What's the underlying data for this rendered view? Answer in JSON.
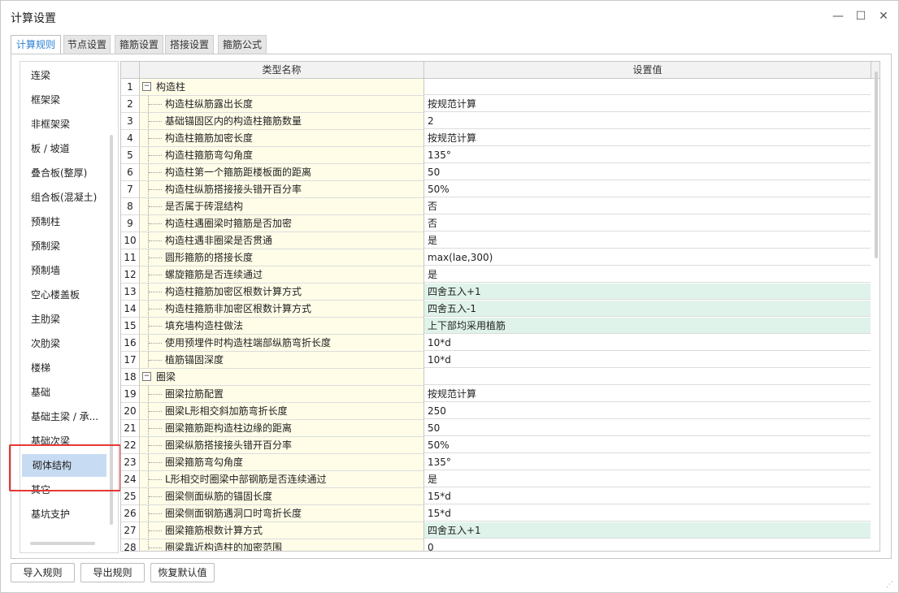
{
  "window": {
    "title": "计算设置",
    "minimize": "—",
    "maximize": "☐",
    "close": "✕"
  },
  "tabs": [
    {
      "label": "计算规则",
      "active": true
    },
    {
      "label": "节点设置"
    },
    {
      "label": "箍筋设置"
    },
    {
      "label": "搭接设置"
    },
    {
      "label": "箍筋公式"
    }
  ],
  "sidebar": {
    "items": [
      "连梁",
      "框架梁",
      "非框架梁",
      "板 / 坡道",
      "叠合板(整厚)",
      "组合板(混凝土)",
      "预制柱",
      "预制梁",
      "预制墙",
      "空心楼盖板",
      "主肋梁",
      "次肋梁",
      "楼梯",
      "基础",
      "基础主梁 / 承...",
      "基础次梁",
      "砌体结构",
      "其它",
      "基坑支护"
    ],
    "selected_index": 16
  },
  "grid": {
    "headers": {
      "name": "类型名称",
      "value": "设置值"
    },
    "rows": [
      {
        "no": "1",
        "name": "构造柱",
        "value": "",
        "group": true
      },
      {
        "no": "2",
        "name": "构造柱纵筋露出长度",
        "value": "按规范计算"
      },
      {
        "no": "3",
        "name": "基础锚固区内的构造柱箍筋数量",
        "value": "2"
      },
      {
        "no": "4",
        "name": "构造柱箍筋加密长度",
        "value": "按规范计算"
      },
      {
        "no": "5",
        "name": "构造柱箍筋弯勾角度",
        "value": "135°"
      },
      {
        "no": "6",
        "name": "构造柱第一个箍筋距楼板面的距离",
        "value": "50"
      },
      {
        "no": "7",
        "name": "构造柱纵筋搭接接头错开百分率",
        "value": "50%"
      },
      {
        "no": "8",
        "name": "是否属于砖混结构",
        "value": "否"
      },
      {
        "no": "9",
        "name": "构造柱遇圈梁时箍筋是否加密",
        "value": "否"
      },
      {
        "no": "10",
        "name": "构造柱遇非圈梁是否贯通",
        "value": "是"
      },
      {
        "no": "11",
        "name": "圆形箍筋的搭接长度",
        "value": "max(lae,300)"
      },
      {
        "no": "12",
        "name": "螺旋箍筋是否连续通过",
        "value": "是"
      },
      {
        "no": "13",
        "name": "构造柱箍筋加密区根数计算方式",
        "value": "四舍五入+1",
        "highlight": true
      },
      {
        "no": "14",
        "name": "构造柱箍筋非加密区根数计算方式",
        "value": "四舍五入-1",
        "highlight": true
      },
      {
        "no": "15",
        "name": "填充墙构造柱做法",
        "value": "上下部均采用植筋",
        "highlight": true
      },
      {
        "no": "16",
        "name": "使用预埋件时构造柱端部纵筋弯折长度",
        "value": "10*d"
      },
      {
        "no": "17",
        "name": "植筋锚固深度",
        "value": "10*d"
      },
      {
        "no": "18",
        "name": "圈梁",
        "value": "",
        "group": true
      },
      {
        "no": "19",
        "name": "圈梁拉筋配置",
        "value": "按规范计算"
      },
      {
        "no": "20",
        "name": "圈梁L形相交斜加筋弯折长度",
        "value": "250"
      },
      {
        "no": "21",
        "name": "圈梁箍筋距构造柱边缘的距离",
        "value": "50"
      },
      {
        "no": "22",
        "name": "圈梁纵筋搭接接头错开百分率",
        "value": "50%"
      },
      {
        "no": "23",
        "name": "圈梁箍筋弯勾角度",
        "value": "135°"
      },
      {
        "no": "24",
        "name": "L形相交时圈梁中部钢筋是否连续通过",
        "value": "是"
      },
      {
        "no": "25",
        "name": "圈梁侧面纵筋的锚固长度",
        "value": "15*d"
      },
      {
        "no": "26",
        "name": "圈梁侧面钢筋遇洞口时弯折长度",
        "value": "15*d"
      },
      {
        "no": "27",
        "name": "圈梁箍筋根数计算方式",
        "value": "四舍五入+1",
        "highlight": true
      },
      {
        "no": "28",
        "name": "圈梁靠近构造柱的加密范围",
        "value": "0"
      }
    ]
  },
  "buttons": {
    "import": "导入规则",
    "export": "导出规则",
    "restore": "恢复默认值"
  }
}
